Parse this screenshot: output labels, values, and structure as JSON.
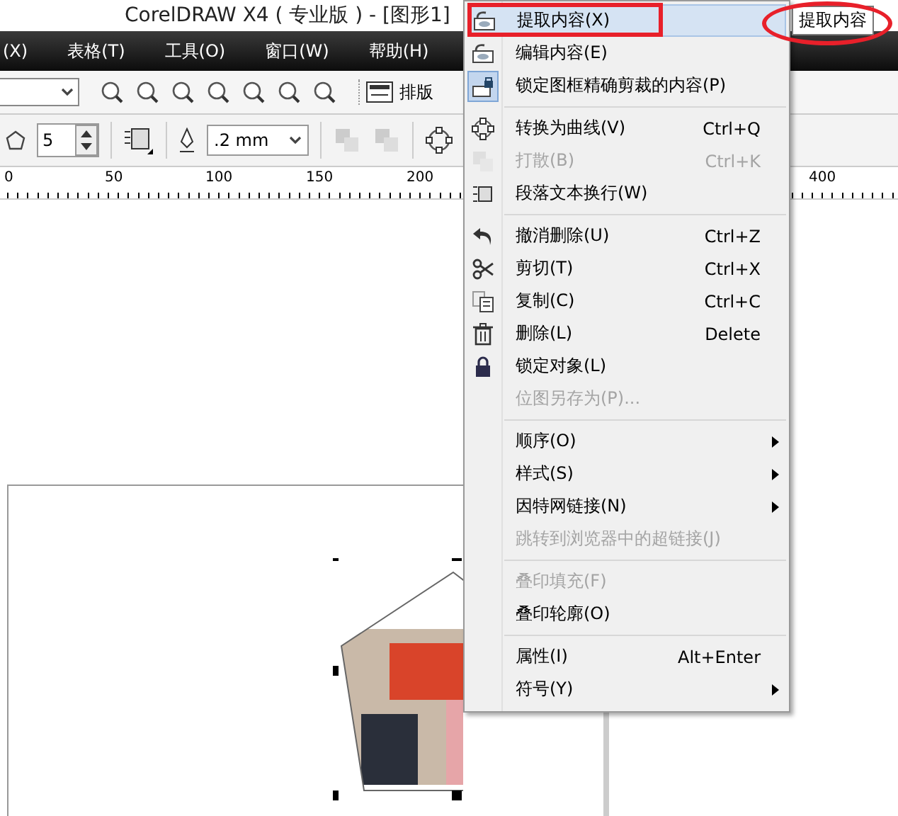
{
  "window": {
    "title": "CorelDRAW X4 ( 专业版 ) - [图形1]"
  },
  "menu_bar": [
    "(X)",
    "表格(T)",
    "工具(O)",
    "窗口(W)",
    "帮助(H)"
  ],
  "toolbar": {
    "layout_button": "排版"
  },
  "property_bar": {
    "sides": "5",
    "outline_width": ".2 mm"
  },
  "ruler": [
    "0",
    "50",
    "100",
    "150",
    "200",
    "400"
  ],
  "context_menu": [
    {
      "kind": "item",
      "label": "提取内容(X)",
      "selected": true,
      "disabled": false,
      "submenu": false
    },
    {
      "kind": "item",
      "label": "编辑内容(E)",
      "selected": false,
      "disabled": false,
      "submenu": false
    },
    {
      "kind": "item",
      "label": "锁定图框精确剪裁的内容(P)",
      "selected": false,
      "disabled": false,
      "submenu": false,
      "checked": true
    },
    {
      "kind": "separator"
    },
    {
      "kind": "item",
      "label": "转换为曲线(V)",
      "shortcut": "Ctrl+Q",
      "selected": false,
      "disabled": false,
      "submenu": false
    },
    {
      "kind": "item",
      "label": "打散(B)",
      "shortcut": "Ctrl+K",
      "selected": false,
      "disabled": true,
      "submenu": false
    },
    {
      "kind": "item",
      "label": "段落文本换行(W)",
      "selected": false,
      "disabled": false,
      "submenu": false
    },
    {
      "kind": "separator"
    },
    {
      "kind": "item",
      "label": "撤消删除(U)",
      "shortcut": "Ctrl+Z",
      "selected": false,
      "disabled": false,
      "submenu": false
    },
    {
      "kind": "item",
      "label": "剪切(T)",
      "shortcut": "Ctrl+X",
      "selected": false,
      "disabled": false,
      "submenu": false
    },
    {
      "kind": "item",
      "label": "复制(C)",
      "shortcut": "Ctrl+C",
      "selected": false,
      "disabled": false,
      "submenu": false
    },
    {
      "kind": "item",
      "label": "删除(L)",
      "shortcut": "Delete",
      "selected": false,
      "disabled": false,
      "submenu": false
    },
    {
      "kind": "item",
      "label": "锁定对象(L)",
      "selected": false,
      "disabled": false,
      "submenu": false
    },
    {
      "kind": "item",
      "label": "位图另存为(P)...",
      "selected": false,
      "disabled": true,
      "submenu": false
    },
    {
      "kind": "separator"
    },
    {
      "kind": "item",
      "label": "顺序(O)",
      "selected": false,
      "disabled": false,
      "submenu": true
    },
    {
      "kind": "item",
      "label": "样式(S)",
      "selected": false,
      "disabled": false,
      "submenu": true
    },
    {
      "kind": "item",
      "label": "因特网链接(N)",
      "selected": false,
      "disabled": false,
      "submenu": true
    },
    {
      "kind": "item",
      "label": "跳转到浏览器中的超链接(J)",
      "selected": false,
      "disabled": true,
      "submenu": false
    },
    {
      "kind": "separator"
    },
    {
      "kind": "item",
      "label": "叠印填充(F)",
      "selected": false,
      "disabled": true,
      "submenu": false
    },
    {
      "kind": "item",
      "label": "叠印轮廓(O)",
      "selected": false,
      "disabled": false,
      "submenu": false
    },
    {
      "kind": "separator"
    },
    {
      "kind": "item",
      "label": "属性(I)",
      "shortcut": "Alt+Enter",
      "selected": false,
      "disabled": false,
      "submenu": false
    },
    {
      "kind": "item",
      "label": "符号(Y)",
      "selected": false,
      "disabled": false,
      "submenu": true
    }
  ],
  "tooltip": "提取内容"
}
